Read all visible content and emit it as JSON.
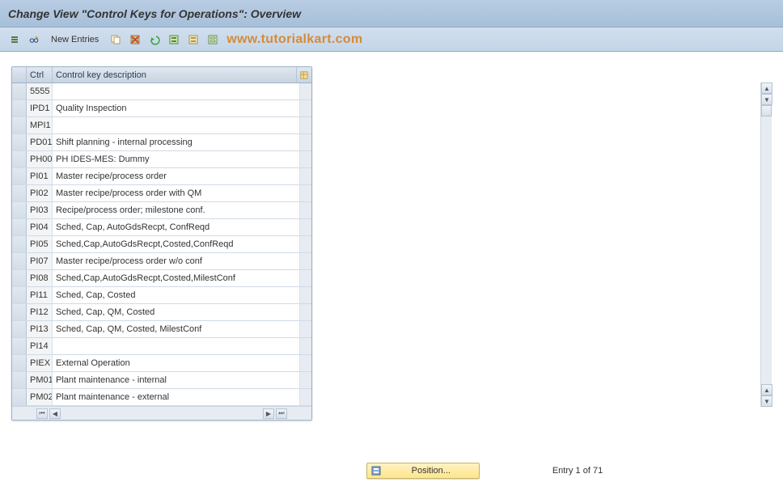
{
  "header": {
    "title": "Change View \"Control Keys for Operations\": Overview"
  },
  "toolbar": {
    "new_entries_label": "New Entries",
    "watermark": "www.tutorialkart.com"
  },
  "table": {
    "columns": {
      "ctrl": "Ctrl",
      "desc": "Control key description"
    },
    "rows": [
      {
        "code": "5555",
        "desc": ""
      },
      {
        "code": "IPD1",
        "desc": "Quality Inspection"
      },
      {
        "code": "MPI1",
        "desc": ""
      },
      {
        "code": "PD01",
        "desc": "Shift planning - internal processing"
      },
      {
        "code": "PH00",
        "desc": "PH IDES-MES: Dummy"
      },
      {
        "code": "PI01",
        "desc": "Master recipe/process order"
      },
      {
        "code": "PI02",
        "desc": "Master recipe/process order with QM"
      },
      {
        "code": "PI03",
        "desc": "Recipe/process order; milestone conf."
      },
      {
        "code": "PI04",
        "desc": "Sched, Cap, AutoGdsRecpt, ConfReqd"
      },
      {
        "code": "PI05",
        "desc": "Sched,Cap,AutoGdsRecpt,Costed,ConfReqd"
      },
      {
        "code": "PI07",
        "desc": "Master recipe/process order w/o conf"
      },
      {
        "code": "PI08",
        "desc": "Sched,Cap,AutoGdsRecpt,Costed,MilestConf"
      },
      {
        "code": "PI11",
        "desc": "Sched, Cap, Costed"
      },
      {
        "code": "PI12",
        "desc": "Sched, Cap, QM, Costed"
      },
      {
        "code": "PI13",
        "desc": "Sched, Cap, QM, Costed, MilestConf"
      },
      {
        "code": "PI14",
        "desc": ""
      },
      {
        "code": "PIEX",
        "desc": "External Operation"
      },
      {
        "code": "PM01",
        "desc": "Plant maintenance - internal"
      },
      {
        "code": "PM02",
        "desc": "Plant maintenance - external"
      }
    ]
  },
  "footer": {
    "position_label": "Position...",
    "entry_status": "Entry 1 of 71"
  }
}
